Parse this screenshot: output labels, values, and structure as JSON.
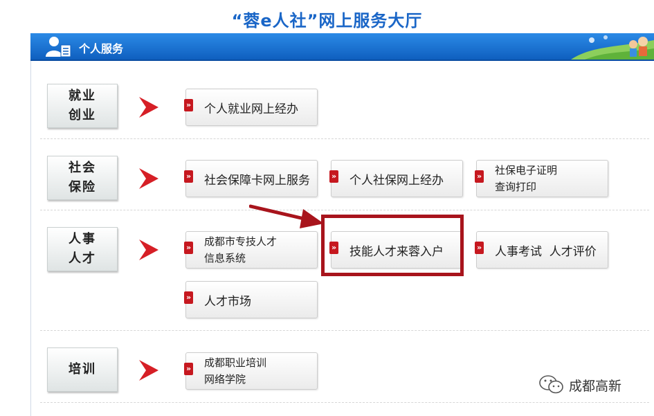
{
  "page_title": "“蓉e人社”网上服务大厅",
  "header": {
    "title": "个人服务"
  },
  "categories": [
    {
      "line1": "就业",
      "line2": "创业"
    },
    {
      "line1": "社会",
      "line2": "保险"
    },
    {
      "line1": "人事",
      "line2": "人才"
    },
    {
      "line1": "培训",
      "line2": ""
    }
  ],
  "services": {
    "employment": [
      "个人就业网上经办"
    ],
    "insurance": [
      "社会保障卡网上服务",
      "个人社保网上经办",
      "社保电子证明",
      "查询打印"
    ],
    "talent": [
      "成都市专技人才",
      "信息系统",
      "技能人才来蓉入户",
      "人事考试  人才评价",
      "人才市场"
    ],
    "training": [
      "成都职业培训",
      "网络学院"
    ]
  },
  "tag_glyph": "»",
  "watermark": "成都高新",
  "colors": {
    "brand_blue": "#1a66c7",
    "header_bar": "#1a72d3",
    "accent_red": "#c6181f",
    "highlight_red": "#a8141c"
  }
}
